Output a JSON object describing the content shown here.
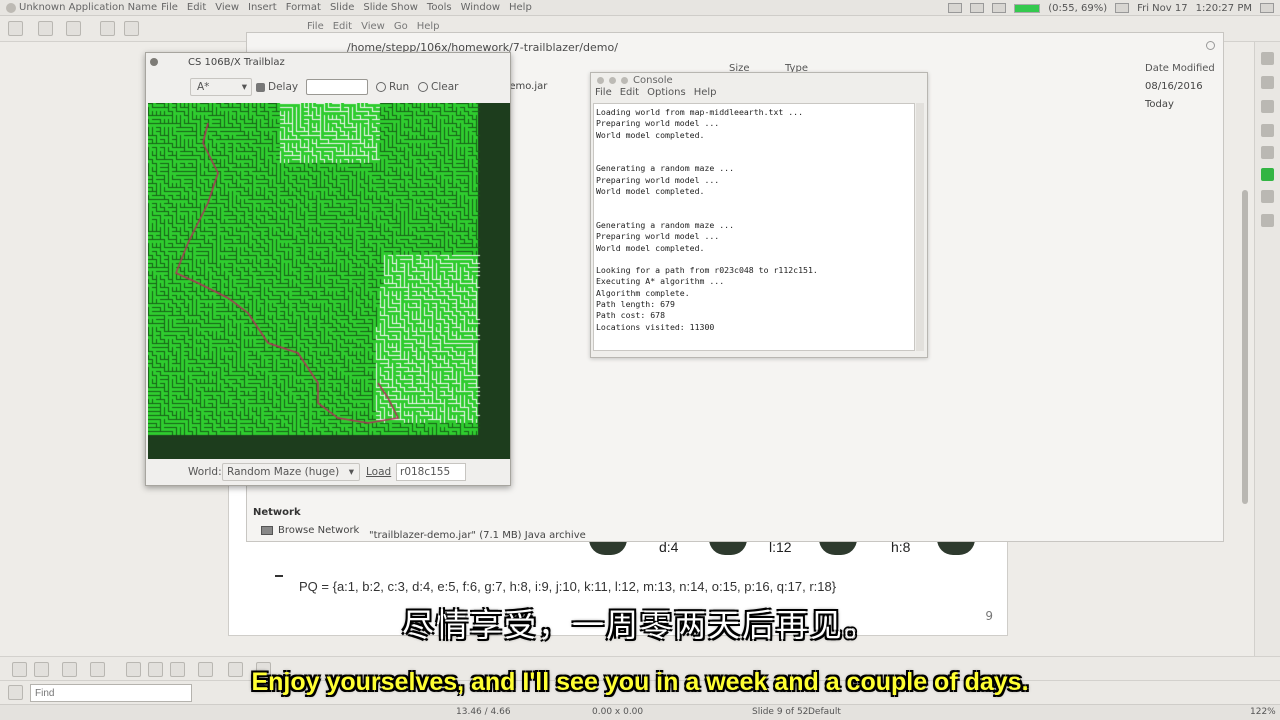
{
  "topbar": {
    "app_name": "Unknown Application Name",
    "menu": [
      "File",
      "Edit",
      "View",
      "Insert",
      "Format",
      "Slide",
      "Slide Show",
      "Tools",
      "Window",
      "Help"
    ],
    "battery": "(0:55, 69%)",
    "date": "Fri Nov 17",
    "time": "1:20:27 PM"
  },
  "file_manager": {
    "menu": [
      "File",
      "Edit",
      "View",
      "Go",
      "Help"
    ],
    "path": "/home/stepp/106x/homework/7-trailblazer/demo/",
    "col_size": "Size",
    "col_type": "Type",
    "col_date": "Date Modified",
    "row1_name": "demo.jar",
    "row1_date": "08/16/2016",
    "row2_date": "Today",
    "network_header": "Network",
    "browse_network": "Browse Network",
    "status": "\"trailblazer-demo.jar\" (7.1 MB) Java archive"
  },
  "console": {
    "title": "Console",
    "menu": [
      "File",
      "Edit",
      "Options",
      "Help"
    ],
    "lines": "Loading world from map-middleearth.txt ...\nPreparing world model ...\nWorld model completed.\n\n\nGenerating a random maze ...\nPreparing world model ...\nWorld model completed.\n\n\nGenerating a random maze ...\nPreparing world model ...\nWorld model completed.\n\nLooking for a path from r023c048 to r112c151.\nExecuting A* algorithm ...\nAlgorithm complete.\nPath length: 679\nPath cost: 678\nLocations visited: 11300"
  },
  "trailblazer": {
    "title": "CS 106B/X Trailblaz",
    "algorithm": "A*",
    "delay_label": "Delay",
    "run_label": "Run",
    "clear_label": "Clear",
    "world_label": "World:",
    "world_value": "Random Maze (huge)",
    "load_label": "Load",
    "coord_value": "r018c155"
  },
  "slide": {
    "labels": [
      "d:4",
      "l:12",
      "h:8"
    ],
    "pq": "PQ = {a:1, b:2, c:3, d:4, e:5, f:6, g:7, h:8, i:9, j:10, k:11, l:12, m:13, n:14, o:15, p:16, q:17, r:18}",
    "number": "9"
  },
  "find": {
    "placeholder": "Find"
  },
  "status": {
    "position": "13.46 / 4.66",
    "size": "0.00 x 0.00",
    "slide": "Slide 9 of 52",
    "layout": "Default",
    "zoom": "122%"
  },
  "subtitles": {
    "cn": "尽情享受，一周零两天后再见。",
    "en": "Enjoy yourselves, and I'll see you in a week and a couple of days."
  },
  "colors": {
    "maze_green": "#2fcc2f",
    "maze_dark": "#1d3d1d",
    "visited_white": "#f4f4f4",
    "path_red": "#b0305a"
  }
}
